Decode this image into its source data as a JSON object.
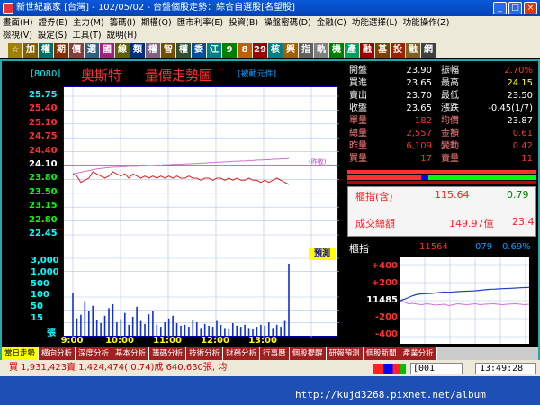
{
  "window": {
    "title": "新世紀贏家 [台灣] - 102/05/02 - 台盤個股走勢：綜合自選股[名望股]",
    "controls": [
      "_",
      "□",
      "×"
    ]
  },
  "menu": {
    "items": [
      "畫面(H)",
      "證券(E)",
      "主力(M)",
      "籌碼(I)",
      "期權(Q)",
      "匯市利率(E)",
      "投資(B)",
      "操盤密碼(D)",
      "金融(C)",
      "功能選擇(L)",
      "功能操作(Z)"
    ]
  },
  "menu2": {
    "items": [
      "檢視(V)",
      "設定(S)",
      "工具(T)",
      "說明(H)"
    ]
  },
  "toolbar": {
    "buttons": [
      "☆",
      "加",
      "權",
      "期",
      "價",
      "選",
      "國",
      "線",
      "類",
      "權",
      "智",
      "權",
      "委",
      "江",
      "9",
      "8",
      "29",
      "核",
      "興",
      "指",
      "軌",
      "機",
      "產",
      "融",
      "基",
      "投",
      "融",
      "網"
    ],
    "colors": [
      "#a08000",
      "#806000",
      "#007060",
      "#803000",
      "#804040",
      "#306080",
      "#a02080",
      "#606000",
      "#003080",
      "#806080",
      "#705000",
      "#305030",
      "#0050a0",
      "#008080",
      "#008000",
      "#c06000",
      "#a00000",
      "#008080",
      "#a06000",
      "#606060",
      "#808080",
      "#008000",
      "#00a060",
      "#a00000",
      "#804000",
      "#a02000",
      "#806020",
      "#404040"
    ]
  },
  "stock": {
    "code": "[8080]",
    "name": "奧斯特",
    "chart_title": "量價走勢圖",
    "note": "[被動元件]"
  },
  "quote": {
    "rows": [
      {
        "l1": "開盤",
        "v1": "23.90",
        "l2": "振幅",
        "v2": "2.70%",
        "c1": "#ffffff",
        "cv1": "#ffffff",
        "cv2": "#ff3030"
      },
      {
        "l1": "買進",
        "v1": "23.65",
        "l2": "最高",
        "v2": "24.15",
        "c1": "#ffffff",
        "cv1": "#ffffff",
        "cv2": "#ffff00"
      },
      {
        "l1": "賣出",
        "v1": "23.70",
        "l2": "最低",
        "v2": "23.50",
        "c1": "#ffffff",
        "cv1": "#ffffff",
        "cv2": "#ffffff"
      },
      {
        "l1": "收盤",
        "v1": "23.65",
        "l2": "漲跌",
        "v2": "-0.45(1/7)",
        "c1": "#ffffff",
        "cv1": "#ffffff",
        "cv2": "#ffffff"
      },
      {
        "l1": "單量",
        "v1": "182",
        "l2": "均價",
        "v2": "23.87",
        "c1": "#ff8080",
        "cv1": "#ff3030",
        "cv2": "#ffffff"
      },
      {
        "l1": "總量",
        "v1": "2,557",
        "l2": "金額",
        "v2": "0.61",
        "c1": "#ff8080",
        "cv1": "#ff3030",
        "cv2": "#ff3030"
      },
      {
        "l1": "昨量",
        "v1": "6,109",
        "l2": "變動",
        "v2": "0.42",
        "c1": "#ff8080",
        "cv1": "#ff3030",
        "cv2": "#ff3030"
      },
      {
        "l1": "買量",
        "v1": "17",
        "l2": "賣量",
        "v2": "11",
        "c1": "#ff8080",
        "cv1": "#ff3030",
        "cv2": "#ff3030"
      }
    ]
  },
  "index_box": {
    "label": "櫃指(含)",
    "value": "115.64",
    "change": "0.79",
    "turnover_label": "成交總額",
    "turnover_value": "149.97億",
    "turnover_extra": "23.4"
  },
  "index_panel": {
    "label": "櫃指",
    "value": "11564",
    "change": "079",
    "pct": "0.69%",
    "y_labels": [
      "+400",
      "+200",
      "11485",
      "-200",
      "-400"
    ]
  },
  "chart_data": {
    "type": "line",
    "price_axis": [
      "25.75",
      "25.40",
      "25.10",
      "24.75",
      "24.40",
      "24.10",
      "23.80",
      "23.50",
      "23.15",
      "22.80",
      "22.45"
    ],
    "volume_axis": [
      "3,000",
      "1,000",
      "500",
      "100",
      "50",
      "15",
      "張"
    ],
    "x_ticks": [
      "9:00",
      "10:00",
      "11:00",
      "12:00",
      "13:00"
    ],
    "ref_price": 24.1,
    "ref_label": "(昨收)",
    "ylim": [
      22.45,
      25.75
    ],
    "price": [
      23.9,
      23.85,
      23.7,
      23.75,
      23.8,
      23.95,
      23.9,
      23.85,
      23.8,
      23.85,
      23.95,
      23.9,
      23.85,
      23.9,
      23.8,
      23.9,
      23.85,
      23.8,
      23.85,
      23.8,
      23.85,
      23.8,
      23.85,
      23.8,
      23.85,
      23.8,
      23.85,
      23.8,
      23.8,
      23.85,
      23.8,
      23.8,
      23.75,
      23.8,
      23.8,
      23.75,
      23.8,
      23.8,
      23.75,
      23.8,
      23.75,
      23.8,
      23.75,
      23.75,
      23.8,
      23.75,
      23.75,
      23.7,
      23.75,
      23.7,
      23.75,
      23.8,
      23.75,
      23.7,
      23.65
    ],
    "avg": [
      23.9,
      23.92,
      23.94,
      23.96,
      23.98,
      24.0,
      24.02,
      24.03,
      24.04,
      24.05,
      24.06,
      24.06,
      24.07,
      24.07,
      24.08,
      24.08,
      24.08,
      24.09,
      24.09,
      24.1,
      24.1,
      24.11,
      24.11,
      24.12,
      24.12,
      24.13,
      24.13,
      24.13,
      24.14,
      24.14,
      24.15,
      24.15,
      24.16,
      24.16,
      24.17,
      24.17,
      24.18,
      24.18,
      24.19,
      24.19,
      24.2,
      24.2,
      24.21,
      24.21,
      24.22,
      24.22,
      24.23,
      24.23,
      24.24,
      24.24,
      24.25,
      24.25,
      24.26,
      24.26,
      24.27
    ],
    "volume": [
      900,
      150,
      220,
      600,
      300,
      450,
      120,
      80,
      200,
      380,
      500,
      90,
      140,
      260,
      60,
      180,
      420,
      110,
      70,
      230,
      300,
      60,
      40,
      90,
      150,
      200,
      80,
      50,
      60,
      40,
      120,
      90,
      30,
      70,
      50,
      40,
      110,
      60,
      30,
      20,
      80,
      50,
      40,
      60,
      30,
      20,
      40,
      60,
      50,
      90,
      30,
      60,
      40,
      110,
      2600
    ],
    "index_line": [
      11485,
      11500,
      11520,
      11540,
      11555,
      11560,
      11562,
      11565,
      11570,
      11575,
      11580,
      11578,
      11582,
      11585,
      11588,
      11590,
      11592,
      11595,
      11600,
      11605,
      11610,
      11612,
      11615,
      11618,
      11620,
      11622,
      11625,
      11628,
      11630,
      11632
    ],
    "index_line2": [
      11485,
      11470,
      11450,
      11455,
      11445,
      11440,
      11450,
      11445,
      11435,
      11440,
      11445,
      11430,
      11440,
      11450,
      11445,
      11440,
      11445,
      11450,
      11440,
      11445,
      11448,
      11450,
      11445,
      11440,
      11445,
      11448,
      11450,
      11445,
      11440,
      11445
    ]
  },
  "bottom_tabs": [
    "當日走勢",
    "橫向分析",
    "深度分析",
    "基本分析",
    "籌碼分析",
    "技術分析",
    "財務分析",
    "行事曆",
    "個股提醒",
    "研報預測",
    "個股新聞",
    "產業分析"
  ],
  "status": {
    "text": "買 1,931,423賣 1,424,474( 0.74)成 640,630張, 均",
    "code": "[001",
    "time": "13:49:28"
  },
  "watermark": "http://kujd3268.pixnet.net/album"
}
